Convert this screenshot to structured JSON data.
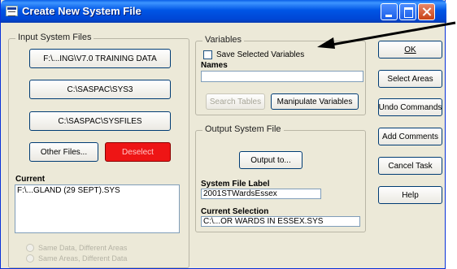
{
  "window": {
    "title": "Create New System File"
  },
  "input_group": {
    "label": "Input System Files",
    "files": [
      "F:\\...ING\\V7.0 TRAINING DATA",
      "C:\\SASPAC\\SYS3",
      "C:\\SASPAC\\SYSFILES"
    ],
    "other_files_label": "Other Files...",
    "deselect_label": "Deselect",
    "current_label": "Current",
    "current_items": [
      "F:\\...GLAND (29 SEPT).SYS"
    ],
    "radio_options": [
      "Same Data, Different Areas",
      "Same Areas, Different Data"
    ]
  },
  "variables_group": {
    "label": "Variables",
    "save_selected_label": "Save Selected Variables",
    "names_label": "Names",
    "names_value": "",
    "search_tables_label": "Search Tables",
    "manipulate_variables_label": "Manipulate Variables"
  },
  "output_group": {
    "label": "Output System File",
    "output_to_label": "Output to...",
    "system_file_label_heading": "System File Label",
    "system_file_label_value": "2001STWardsEssex",
    "current_selection_heading": "Current Selection",
    "current_selection_value": "C:\\...OR WARDS IN ESSEX.SYS"
  },
  "side_buttons": {
    "ok": "OK",
    "select_areas": "Select Areas",
    "undo_commands": "Undo Commands",
    "add_comments": "Add Comments",
    "cancel_task": "Cancel Task",
    "help": "Help"
  },
  "colors": {
    "deselect_bg": "#ee1515",
    "titlebar": "#0055e5",
    "arrow": "#000000"
  }
}
